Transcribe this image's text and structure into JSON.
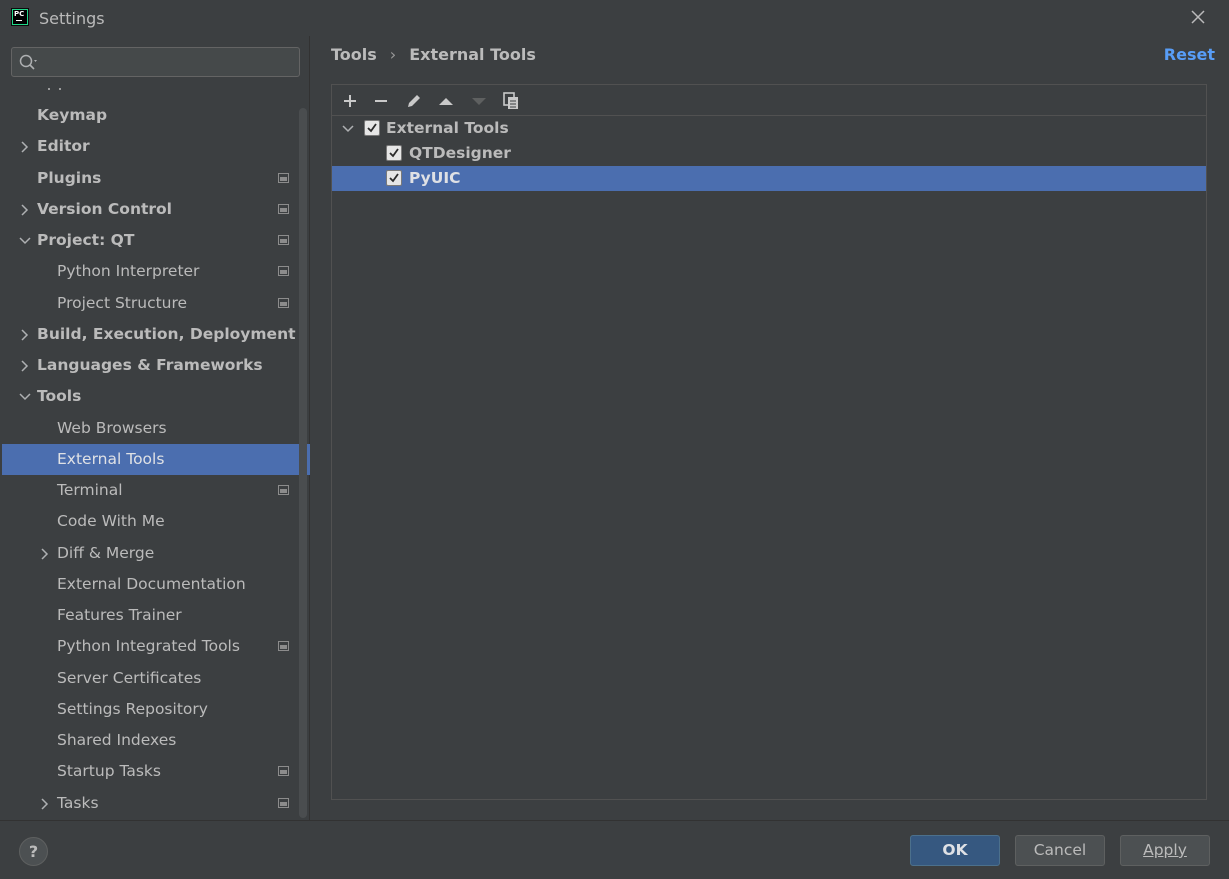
{
  "window": {
    "title": "Settings",
    "close_label": "close"
  },
  "search": {
    "placeholder": "",
    "value": ""
  },
  "sidebar": {
    "items": [
      {
        "label": "Keymap",
        "bold": true,
        "level": 0,
        "expander": "none",
        "settings_icon": false,
        "selected": false
      },
      {
        "label": "Editor",
        "bold": true,
        "level": 0,
        "expander": "collapsed",
        "settings_icon": false,
        "selected": false
      },
      {
        "label": "Plugins",
        "bold": true,
        "level": 0,
        "expander": "none",
        "settings_icon": true,
        "selected": false
      },
      {
        "label": "Version Control",
        "bold": true,
        "level": 0,
        "expander": "collapsed",
        "settings_icon": true,
        "selected": false
      },
      {
        "label": "Project: QT",
        "bold": true,
        "level": 0,
        "expander": "expanded",
        "settings_icon": true,
        "selected": false
      },
      {
        "label": "Python Interpreter",
        "bold": false,
        "level": 1,
        "expander": "none",
        "settings_icon": true,
        "selected": false
      },
      {
        "label": "Project Structure",
        "bold": false,
        "level": 1,
        "expander": "none",
        "settings_icon": true,
        "selected": false
      },
      {
        "label": "Build, Execution, Deployment",
        "bold": true,
        "level": 0,
        "expander": "collapsed",
        "settings_icon": false,
        "selected": false
      },
      {
        "label": "Languages & Frameworks",
        "bold": true,
        "level": 0,
        "expander": "collapsed",
        "settings_icon": false,
        "selected": false
      },
      {
        "label": "Tools",
        "bold": true,
        "level": 0,
        "expander": "expanded",
        "settings_icon": false,
        "selected": false
      },
      {
        "label": "Web Browsers",
        "bold": false,
        "level": 1,
        "expander": "none",
        "settings_icon": false,
        "selected": false
      },
      {
        "label": "External Tools",
        "bold": false,
        "level": 1,
        "expander": "none",
        "settings_icon": false,
        "selected": true
      },
      {
        "label": "Terminal",
        "bold": false,
        "level": 1,
        "expander": "none",
        "settings_icon": true,
        "selected": false
      },
      {
        "label": "Code With Me",
        "bold": false,
        "level": 1,
        "expander": "none",
        "settings_icon": false,
        "selected": false
      },
      {
        "label": "Diff & Merge",
        "bold": false,
        "level": 1,
        "expander": "collapsed",
        "settings_icon": false,
        "selected": false
      },
      {
        "label": "External Documentation",
        "bold": false,
        "level": 1,
        "expander": "none",
        "settings_icon": false,
        "selected": false
      },
      {
        "label": "Features Trainer",
        "bold": false,
        "level": 1,
        "expander": "none",
        "settings_icon": false,
        "selected": false
      },
      {
        "label": "Python Integrated Tools",
        "bold": false,
        "level": 1,
        "expander": "none",
        "settings_icon": true,
        "selected": false
      },
      {
        "label": "Server Certificates",
        "bold": false,
        "level": 1,
        "expander": "none",
        "settings_icon": false,
        "selected": false
      },
      {
        "label": "Settings Repository",
        "bold": false,
        "level": 1,
        "expander": "none",
        "settings_icon": false,
        "selected": false
      },
      {
        "label": "Shared Indexes",
        "bold": false,
        "level": 1,
        "expander": "none",
        "settings_icon": false,
        "selected": false
      },
      {
        "label": "Startup Tasks",
        "bold": false,
        "level": 1,
        "expander": "none",
        "settings_icon": true,
        "selected": false
      },
      {
        "label": "Tasks",
        "bold": false,
        "level": 1,
        "expander": "collapsed",
        "settings_icon": true,
        "selected": false
      }
    ]
  },
  "breadcrumb": {
    "parent": "Tools",
    "separator": "›",
    "current": "External Tools"
  },
  "reset_label": "Reset",
  "toolbar": {
    "buttons": [
      "add-icon",
      "remove-icon",
      "edit-icon",
      "move-up-icon",
      "move-down-icon",
      "copy-icon"
    ]
  },
  "tools_tree": {
    "group": {
      "label": "External Tools",
      "checked": true,
      "expanded": true
    },
    "items": [
      {
        "label": "QTDesigner",
        "checked": true,
        "selected": false
      },
      {
        "label": "PyUIC",
        "checked": true,
        "selected": true
      }
    ]
  },
  "footer": {
    "help_label": "?",
    "ok_label": "OK",
    "cancel_label": "Cancel",
    "apply_label": "Apply"
  },
  "colors": {
    "background": "#3c3f41",
    "selection": "#4b6eaf",
    "link": "#589df6",
    "primary_button": "#365880"
  }
}
